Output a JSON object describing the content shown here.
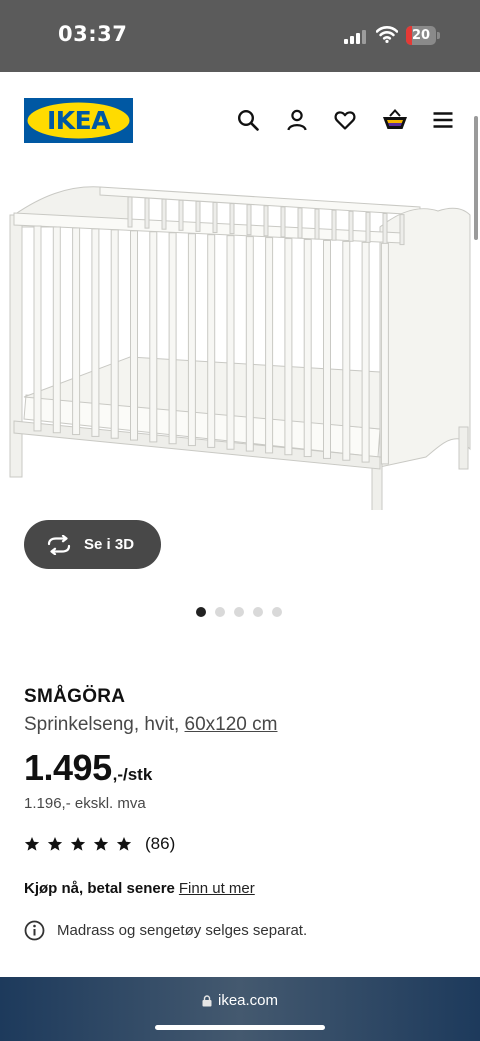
{
  "status": {
    "time": "03:37",
    "battery": "20",
    "battery_level": 0.2,
    "battery_color": "#e53935"
  },
  "header": {
    "logo_text": "IKEA",
    "logo_colors": {
      "blue": "#0058a3",
      "yellow": "#ffdb00"
    },
    "icons": [
      "search-icon",
      "account-icon",
      "heart-icon",
      "basket-icon",
      "menu-icon"
    ]
  },
  "gallery": {
    "view_3d_label": "Se i 3D",
    "image_count": 5,
    "active_index": 0
  },
  "product": {
    "name": "SMÅGÖRA",
    "description": "Sprinkelseng, hvit, ",
    "size": "60x120 cm",
    "price": "1.495",
    "price_unit": ",-/stk",
    "price_ex_vat": "1.196,- ekskl. mva",
    "rating_stars": 5,
    "rating_count": "(86)",
    "bnpl_text": "Kjøp nå, betal senere",
    "bnpl_link": "Finn ut mer",
    "notice": "Madrass og sengetøy selges separat."
  },
  "browser": {
    "url": "ikea.com"
  }
}
